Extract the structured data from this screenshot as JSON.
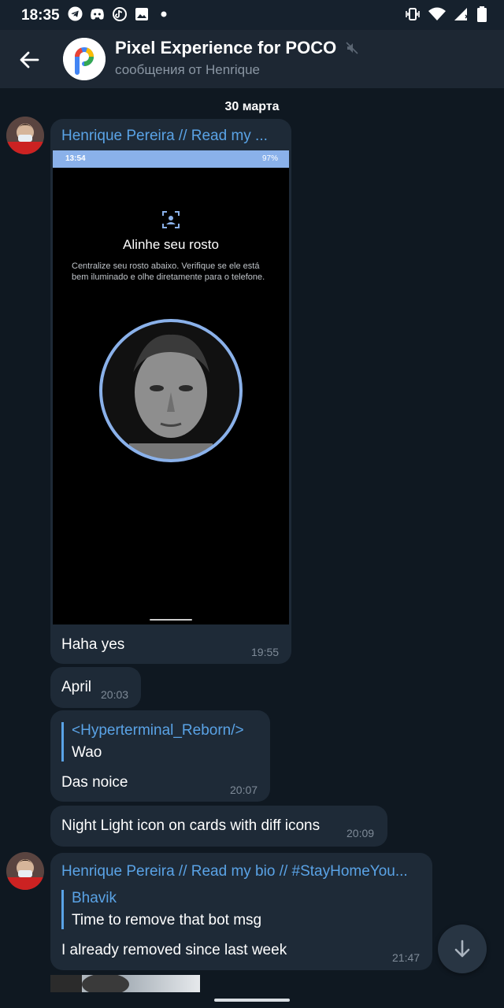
{
  "status_bar": {
    "time": "18:35",
    "left_icons": [
      "telegram-icon",
      "discord-icon",
      "tiktok-icon",
      "image-icon",
      "dot-icon"
    ],
    "right_icons": [
      "vibrate-icon",
      "wifi-icon",
      "signal-icon",
      "battery-icon"
    ]
  },
  "header": {
    "title": "Pixel Experience for POCO",
    "subtitle": "сообщения от Henrique",
    "avatar_caption": "Pixel Experience"
  },
  "date_separator": "30 марта",
  "messages": [
    {
      "sender": "Henrique Pereira // Read my ...",
      "screenshot": {
        "status_time": "13:54",
        "battery": "97%",
        "title": "Alinhe seu rosto",
        "description": "Centralize seu rosto abaixo. Verifique se ele está bem iluminado e olhe diretamente para o telefone."
      },
      "text": "Haha yes",
      "time": "19:55"
    },
    {
      "text": "April",
      "time": "20:03"
    },
    {
      "reply_to": {
        "name": "<Hyperterminal_Reborn/>",
        "text": "Wao"
      },
      "text": "Das noice",
      "time": "20:07"
    },
    {
      "text": "Night Light icon on cards with diff icons",
      "time": "20:09"
    },
    {
      "sender": "Henrique Pereira // Read my bio // #StayHomeYou...",
      "reply_to": {
        "name": "Bhavik",
        "text": "Time to remove that bot msg"
      },
      "text": "I already removed since last week",
      "time": "21:47"
    }
  ],
  "colors": {
    "accent": "#5aa3e6",
    "bubble": "#1e2a37",
    "background": "#0f1821",
    "face_ring": "#8ab1ea"
  }
}
